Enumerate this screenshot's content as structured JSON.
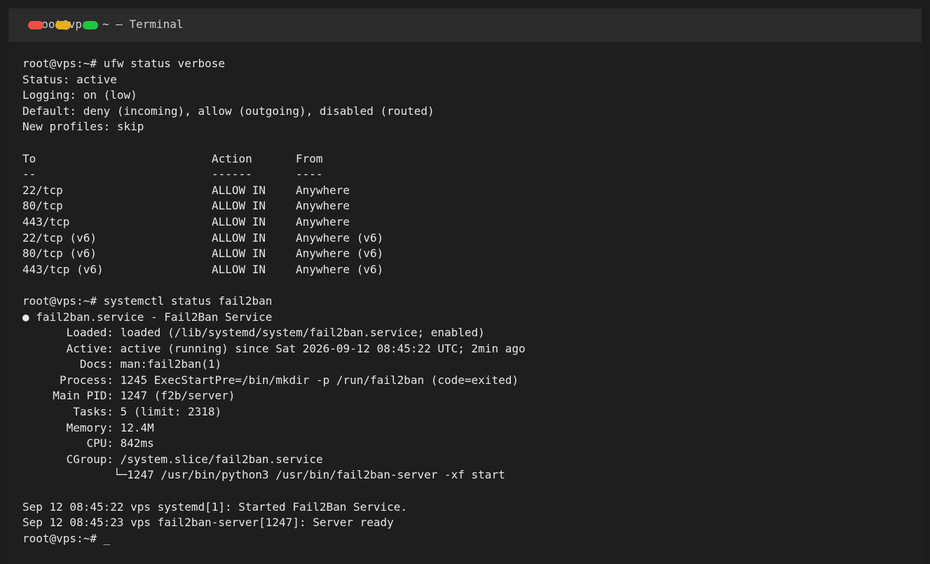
{
  "window": {
    "title": "root@vps: ~ — Terminal",
    "title_display": " root@vps: ~ — Terminal"
  },
  "terminal": {
    "prompt": "root@vps:~# ",
    "cmd1": "ufw status verbose",
    "ufw_status": "Status: active",
    "ufw_logging": "Logging: on (low)",
    "ufw_default": "Default: deny (incoming), allow (outgoing), disabled (routed)",
    "ufw_profiles": "New profiles: skip",
    "headers": {
      "to": "To",
      "action": "Action",
      "from": "From"
    },
    "separators": {
      "to": "--",
      "action": "------",
      "from": "----"
    },
    "rules": [
      {
        "to": "22/tcp",
        "action": "ALLOW IN",
        "from": "Anywhere"
      },
      {
        "to": "80/tcp",
        "action": "ALLOW IN",
        "from": "Anywhere"
      },
      {
        "to": "443/tcp",
        "action": "ALLOW IN",
        "from": "Anywhere"
      },
      {
        "to": "22/tcp (v6)",
        "action": "ALLOW IN",
        "from": "Anywhere (v6)"
      },
      {
        "to": "80/tcp (v6)",
        "action": "ALLOW IN",
        "from": "Anywhere (v6)"
      },
      {
        "to": "443/tcp (v6)",
        "action": "ALLOW IN",
        "from": "Anywhere (v6)"
      }
    ],
    "cmd2": "systemctl status fail2ban",
    "service_line": "● fail2ban.service - Fail2Ban Service",
    "fields": [
      {
        "key": "Loaded:",
        "value": " loaded (/lib/systemd/system/fail2ban.service; enabled)"
      },
      {
        "key": "Active:",
        "value": " active (running) since Sat 2026-09-12 08:45:22 UTC; 2min ago"
      },
      {
        "key": "Docs:",
        "value": " man:fail2ban(1)"
      },
      {
        "key": "Process:",
        "value": " 1245 ExecStartPre=/bin/mkdir -p /run/fail2ban (code=exited)"
      },
      {
        "key": "Main PID:",
        "value": " 1247 (f2b/server)"
      },
      {
        "key": "Tasks:",
        "value": " 5 (limit: 2318)"
      },
      {
        "key": "Memory:",
        "value": " 12.4M"
      },
      {
        "key": "CPU:",
        "value": " 842ms"
      },
      {
        "key": "CGroup:",
        "value": " /system.slice/fail2ban.service"
      }
    ],
    "cgroup_child": "└─1247 /usr/bin/python3 /usr/bin/fail2ban-server -xf start",
    "log1": "Sep 12 08:45:22 vps systemd[1]: Started Fail2Ban Service.",
    "log2": "Sep 12 08:45:23 vps fail2ban-server[1247]: Server ready",
    "cursor": "_"
  },
  "colors": {
    "background": "#1e1e1e",
    "titlebar": "#2b2b2b",
    "text": "#e6e6e6",
    "close": "#ef4e45",
    "minimize": "#e7ae22",
    "maximize": "#20c53e"
  }
}
